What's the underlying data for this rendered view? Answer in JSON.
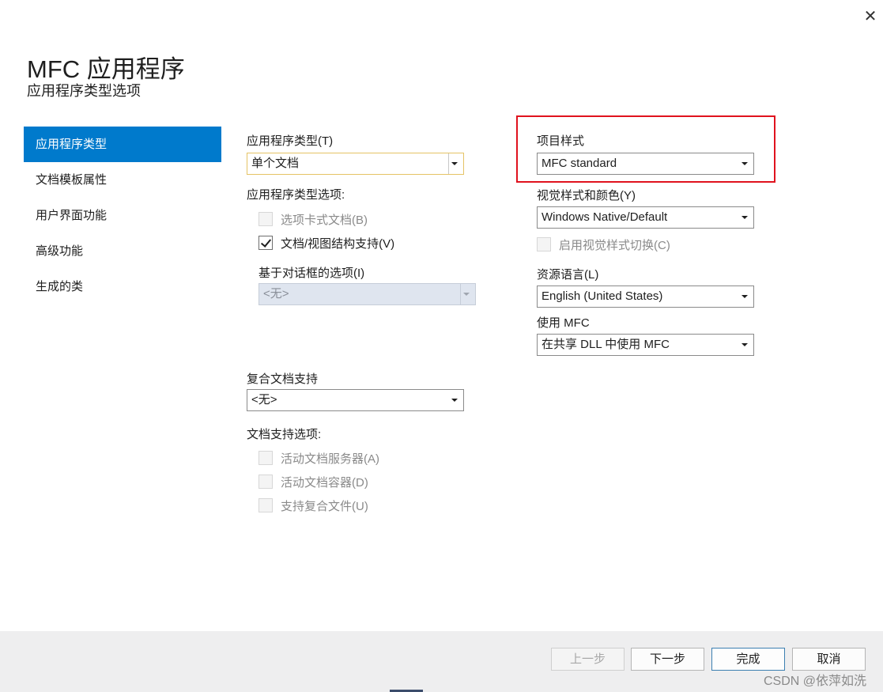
{
  "window": {
    "close_glyph": "✕"
  },
  "header": {
    "title": "MFC 应用程序",
    "subtitle": "应用程序类型选项"
  },
  "sidebar": {
    "items": [
      {
        "label": "应用程序类型",
        "active": true
      },
      {
        "label": "文档模板属性",
        "active": false
      },
      {
        "label": "用户界面功能",
        "active": false
      },
      {
        "label": "高级功能",
        "active": false
      },
      {
        "label": "生成的类",
        "active": false
      }
    ]
  },
  "left_panel": {
    "app_type": {
      "label": "应用程序类型(T)",
      "value": "单个文档"
    },
    "app_type_options_label": "应用程序类型选项:",
    "app_type_options": [
      {
        "label": "选项卡式文档(B)",
        "checked": false,
        "enabled": false
      },
      {
        "label": "文档/视图结构支持(V)",
        "checked": true,
        "enabled": true
      }
    ],
    "dialog_options": {
      "label": "基于对话框的选项(I)",
      "value": "<无>",
      "enabled": false
    },
    "compound_doc": {
      "label": "复合文档支持",
      "value": "<无>"
    },
    "doc_support_label": "文档支持选项:",
    "doc_support_options": [
      {
        "label": "活动文档服务器(A)",
        "checked": false,
        "enabled": false
      },
      {
        "label": "活动文档容器(D)",
        "checked": false,
        "enabled": false
      },
      {
        "label": "支持复合文件(U)",
        "checked": false,
        "enabled": false
      }
    ]
  },
  "right_panel": {
    "project_style": {
      "label": "项目样式",
      "value": "MFC standard"
    },
    "visual_style": {
      "label": "视觉样式和颜色(Y)",
      "value": "Windows Native/Default"
    },
    "enable_visual_switch": {
      "label": "启用视觉样式切换(C)",
      "checked": false,
      "enabled": false
    },
    "resource_language": {
      "label": "资源语言(L)",
      "value": "English (United States)"
    },
    "use_mfc": {
      "label": "使用 MFC",
      "value": "在共享 DLL 中使用 MFC"
    }
  },
  "footer": {
    "prev_label": "上一步",
    "next_label": "下一步",
    "finish_label": "完成",
    "cancel_label": "取消"
  },
  "watermark": "CSDN @依萍如洗",
  "colors": {
    "accent": "#007acc",
    "highlight_border": "#e0121e"
  }
}
